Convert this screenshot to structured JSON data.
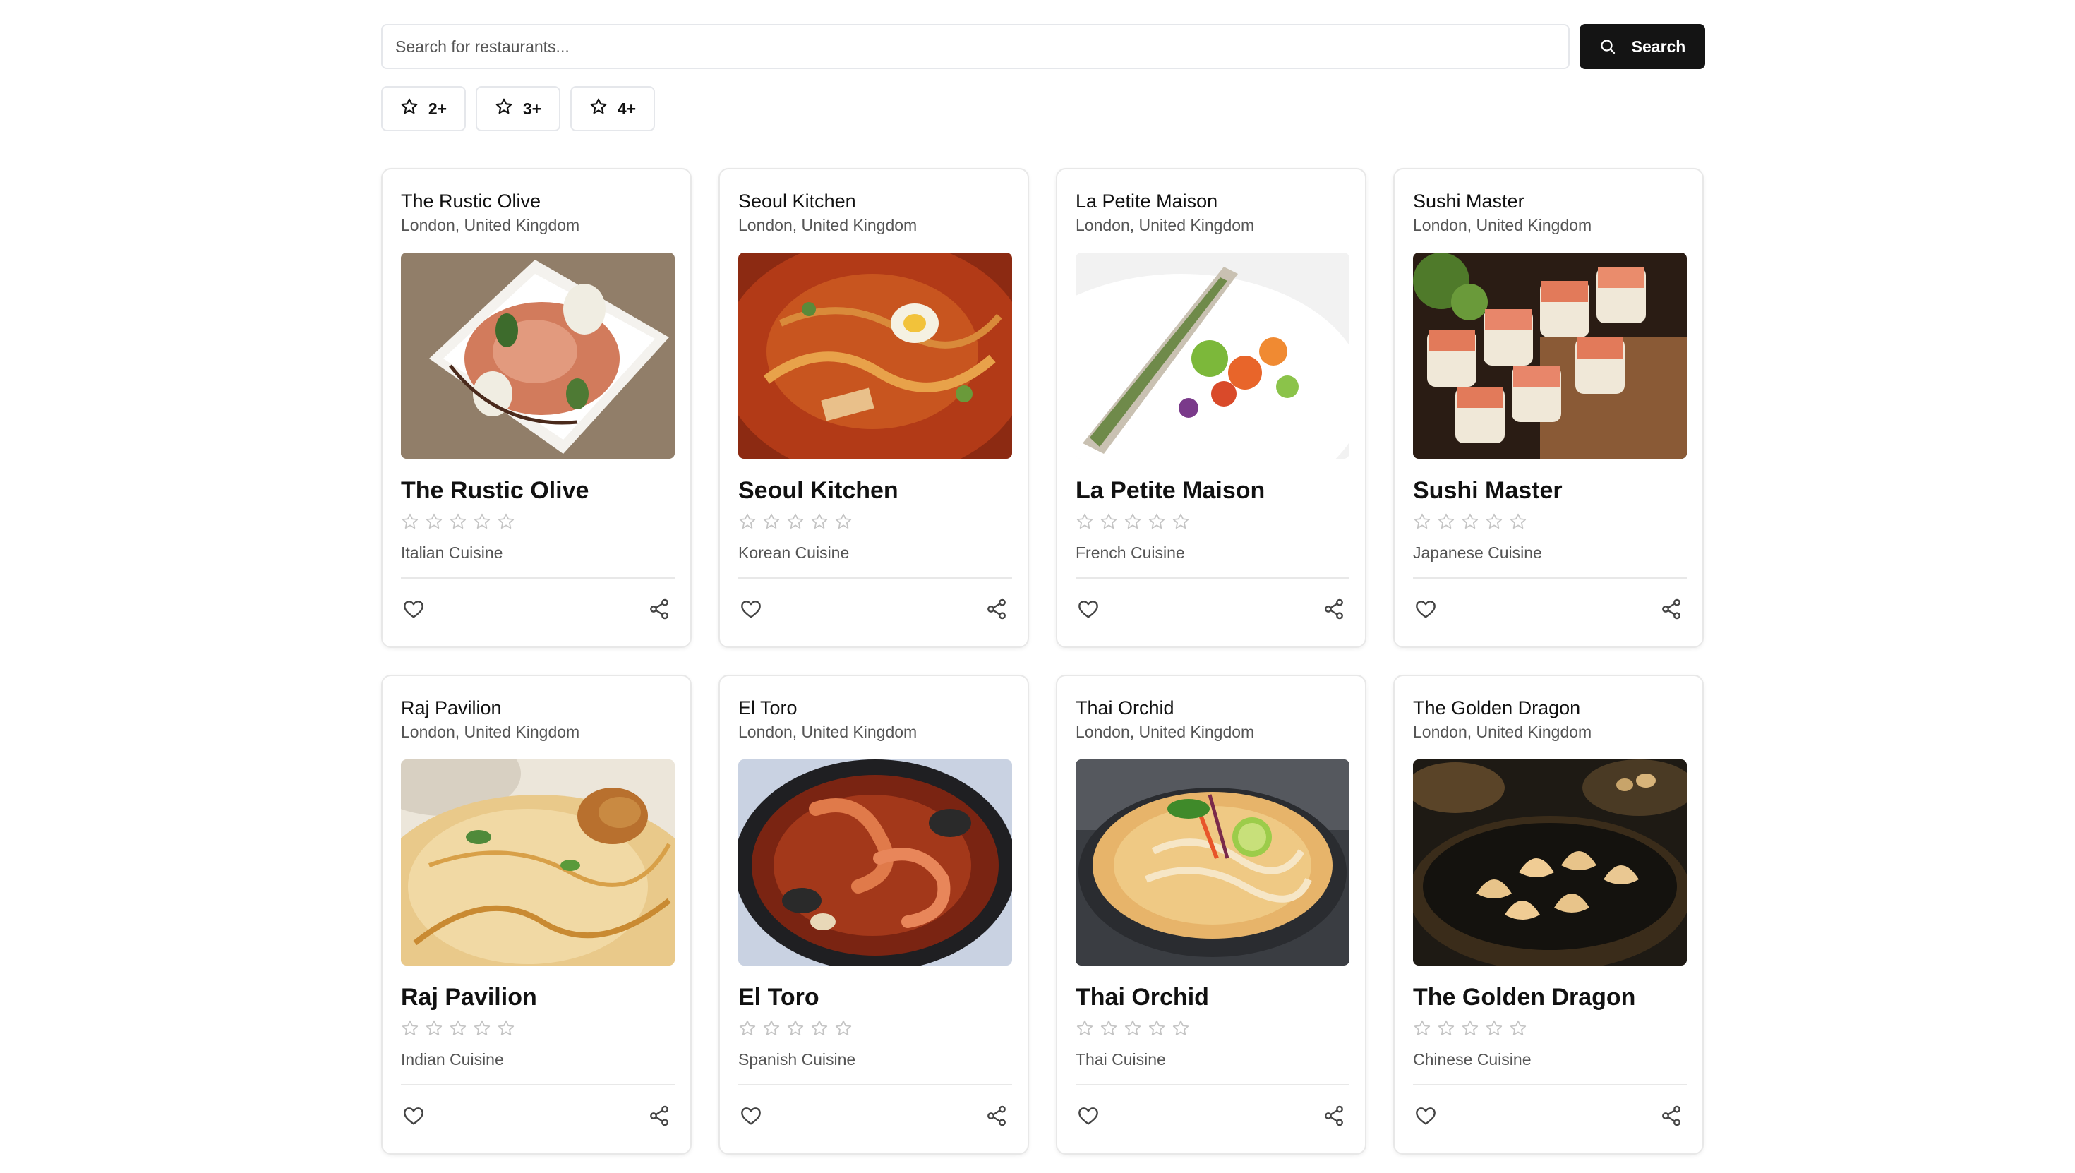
{
  "search": {
    "placeholder": "Search for restaurants...",
    "button_label": "Search",
    "button_icon": "search-icon"
  },
  "filters": [
    {
      "label": "2+",
      "icon": "star-icon"
    },
    {
      "label": "3+",
      "icon": "star-icon"
    },
    {
      "label": "4+",
      "icon": "star-icon"
    }
  ],
  "colors": {
    "button_bg": "#141414",
    "border": "#e5e7eb",
    "muted_text": "#555555",
    "star_outline": "#c4c4c4"
  },
  "restaurants": [
    {
      "name": "The Rustic Olive",
      "location": "London, United Kingdom",
      "cuisine": "Italian Cuisine",
      "rating": 0
    },
    {
      "name": "Seoul Kitchen",
      "location": "London, United Kingdom",
      "cuisine": "Korean Cuisine",
      "rating": 0
    },
    {
      "name": "La Petite Maison",
      "location": "London, United Kingdom",
      "cuisine": "French Cuisine",
      "rating": 0
    },
    {
      "name": "Sushi Master",
      "location": "London, United Kingdom",
      "cuisine": "Japanese Cuisine",
      "rating": 0
    },
    {
      "name": "Raj Pavilion",
      "location": "London, United Kingdom",
      "cuisine": "Indian Cuisine",
      "rating": 0
    },
    {
      "name": "El Toro",
      "location": "London, United Kingdom",
      "cuisine": "Spanish Cuisine",
      "rating": 0
    },
    {
      "name": "Thai Orchid",
      "location": "London, United Kingdom",
      "cuisine": "Thai Cuisine",
      "rating": 0
    },
    {
      "name": "The Golden Dragon",
      "location": "London, United Kingdom",
      "cuisine": "Chinese Cuisine",
      "rating": 0
    }
  ],
  "card_icons": {
    "like": "heart-icon",
    "share": "share-icon"
  }
}
